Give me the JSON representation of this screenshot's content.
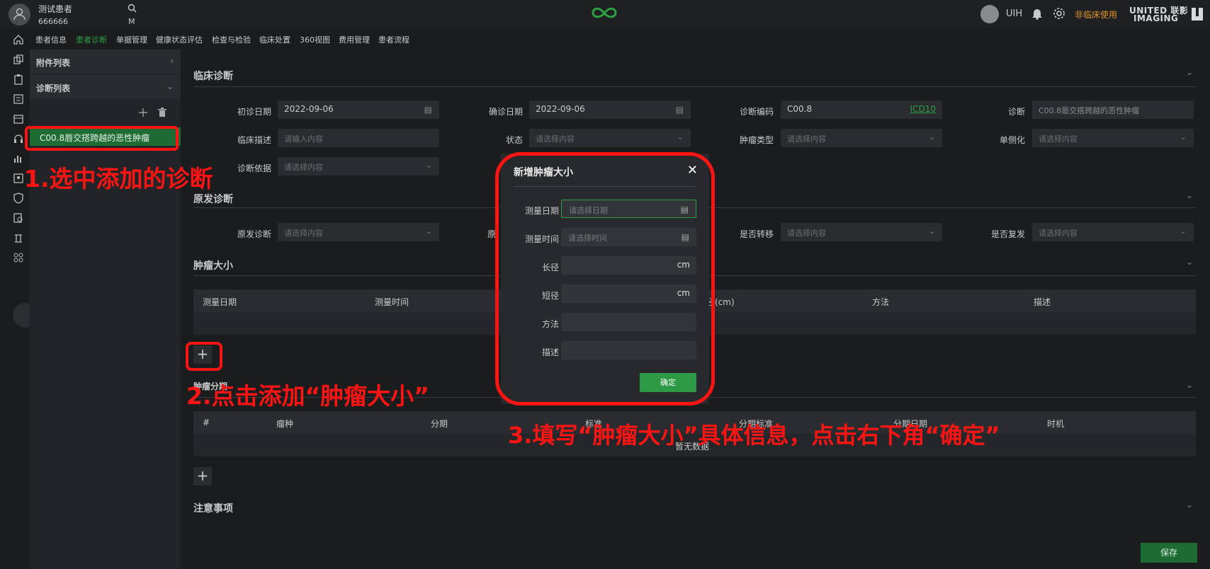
{
  "header": {
    "patient_name": "测试患者",
    "patient_id": "666666",
    "gender": "M",
    "user": "UIH",
    "non_clinical": "非临床使用",
    "brand_line1": "UNITED 联影",
    "brand_line2": "IMAGING"
  },
  "nav": {
    "tabs": [
      "患者信息",
      "患者诊断",
      "单据管理",
      "健康状态评估",
      "检查与检验",
      "临床处置",
      "360视图",
      "费用管理",
      "患者流程"
    ],
    "active": "患者诊断"
  },
  "left_panel": {
    "attachments": "附件列表",
    "diagnosis_list": "诊断列表",
    "selected_item": "C00.8唇交搭跨越的恶性肿瘤"
  },
  "annotations": {
    "a1": "1.选中添加的诊断",
    "a2": "2.点击添加“肿瘤大小”",
    "a3": "3.填写“肿瘤大小”具体信息，点击右下角“确定”"
  },
  "clinical": {
    "title": "临床诊断",
    "first_date_label": "初诊日期",
    "first_date": "2022-09-06",
    "confirm_date_label": "确诊日期",
    "confirm_date": "2022-09-06",
    "code_label": "诊断编码",
    "code": "C00.8",
    "code_system": "ICD10",
    "diag_label": "诊断",
    "diag_value": "C00.8唇交搭跨越的恶性肿瘤",
    "desc_label": "临床描述",
    "desc_ph": "请输入内容",
    "status_label": "状态",
    "select_ph": "请选择内容",
    "tumor_type_label": "肿瘤类型",
    "laterality_label": "单侧化",
    "basis_label": "诊断依据"
  },
  "primary": {
    "title": "原发诊断",
    "primary_label": "原发诊断",
    "primary_label2": "原",
    "metastasis_label": "是否转移",
    "recurrence_label": "是否复发"
  },
  "tumor_size": {
    "title": "肿瘤大小",
    "headers": [
      "测量日期",
      "测量时间",
      "短径(cm)",
      "方法",
      "描述"
    ]
  },
  "staging": {
    "title": "肿瘤分期",
    "headers": [
      "#",
      "瘤种",
      "分期",
      "标准",
      "分期标准",
      "分期日期",
      "时机"
    ],
    "empty": "暂无数据"
  },
  "notes": {
    "title": "注意事项"
  },
  "save_label": "保存",
  "modal": {
    "title": "新增肿瘤大小",
    "date_label": "测量日期",
    "date_ph": "请选择日期",
    "time_label": "测量时间",
    "time_ph": "请选择时间",
    "long_label": "长径",
    "short_label": "短径",
    "unit": "cm",
    "method_label": "方法",
    "desc_label": "描述",
    "ok": "确定"
  },
  "colors": {
    "accent": "#2ea043",
    "annotation": "#ff1414",
    "warning": "#e0932a"
  }
}
